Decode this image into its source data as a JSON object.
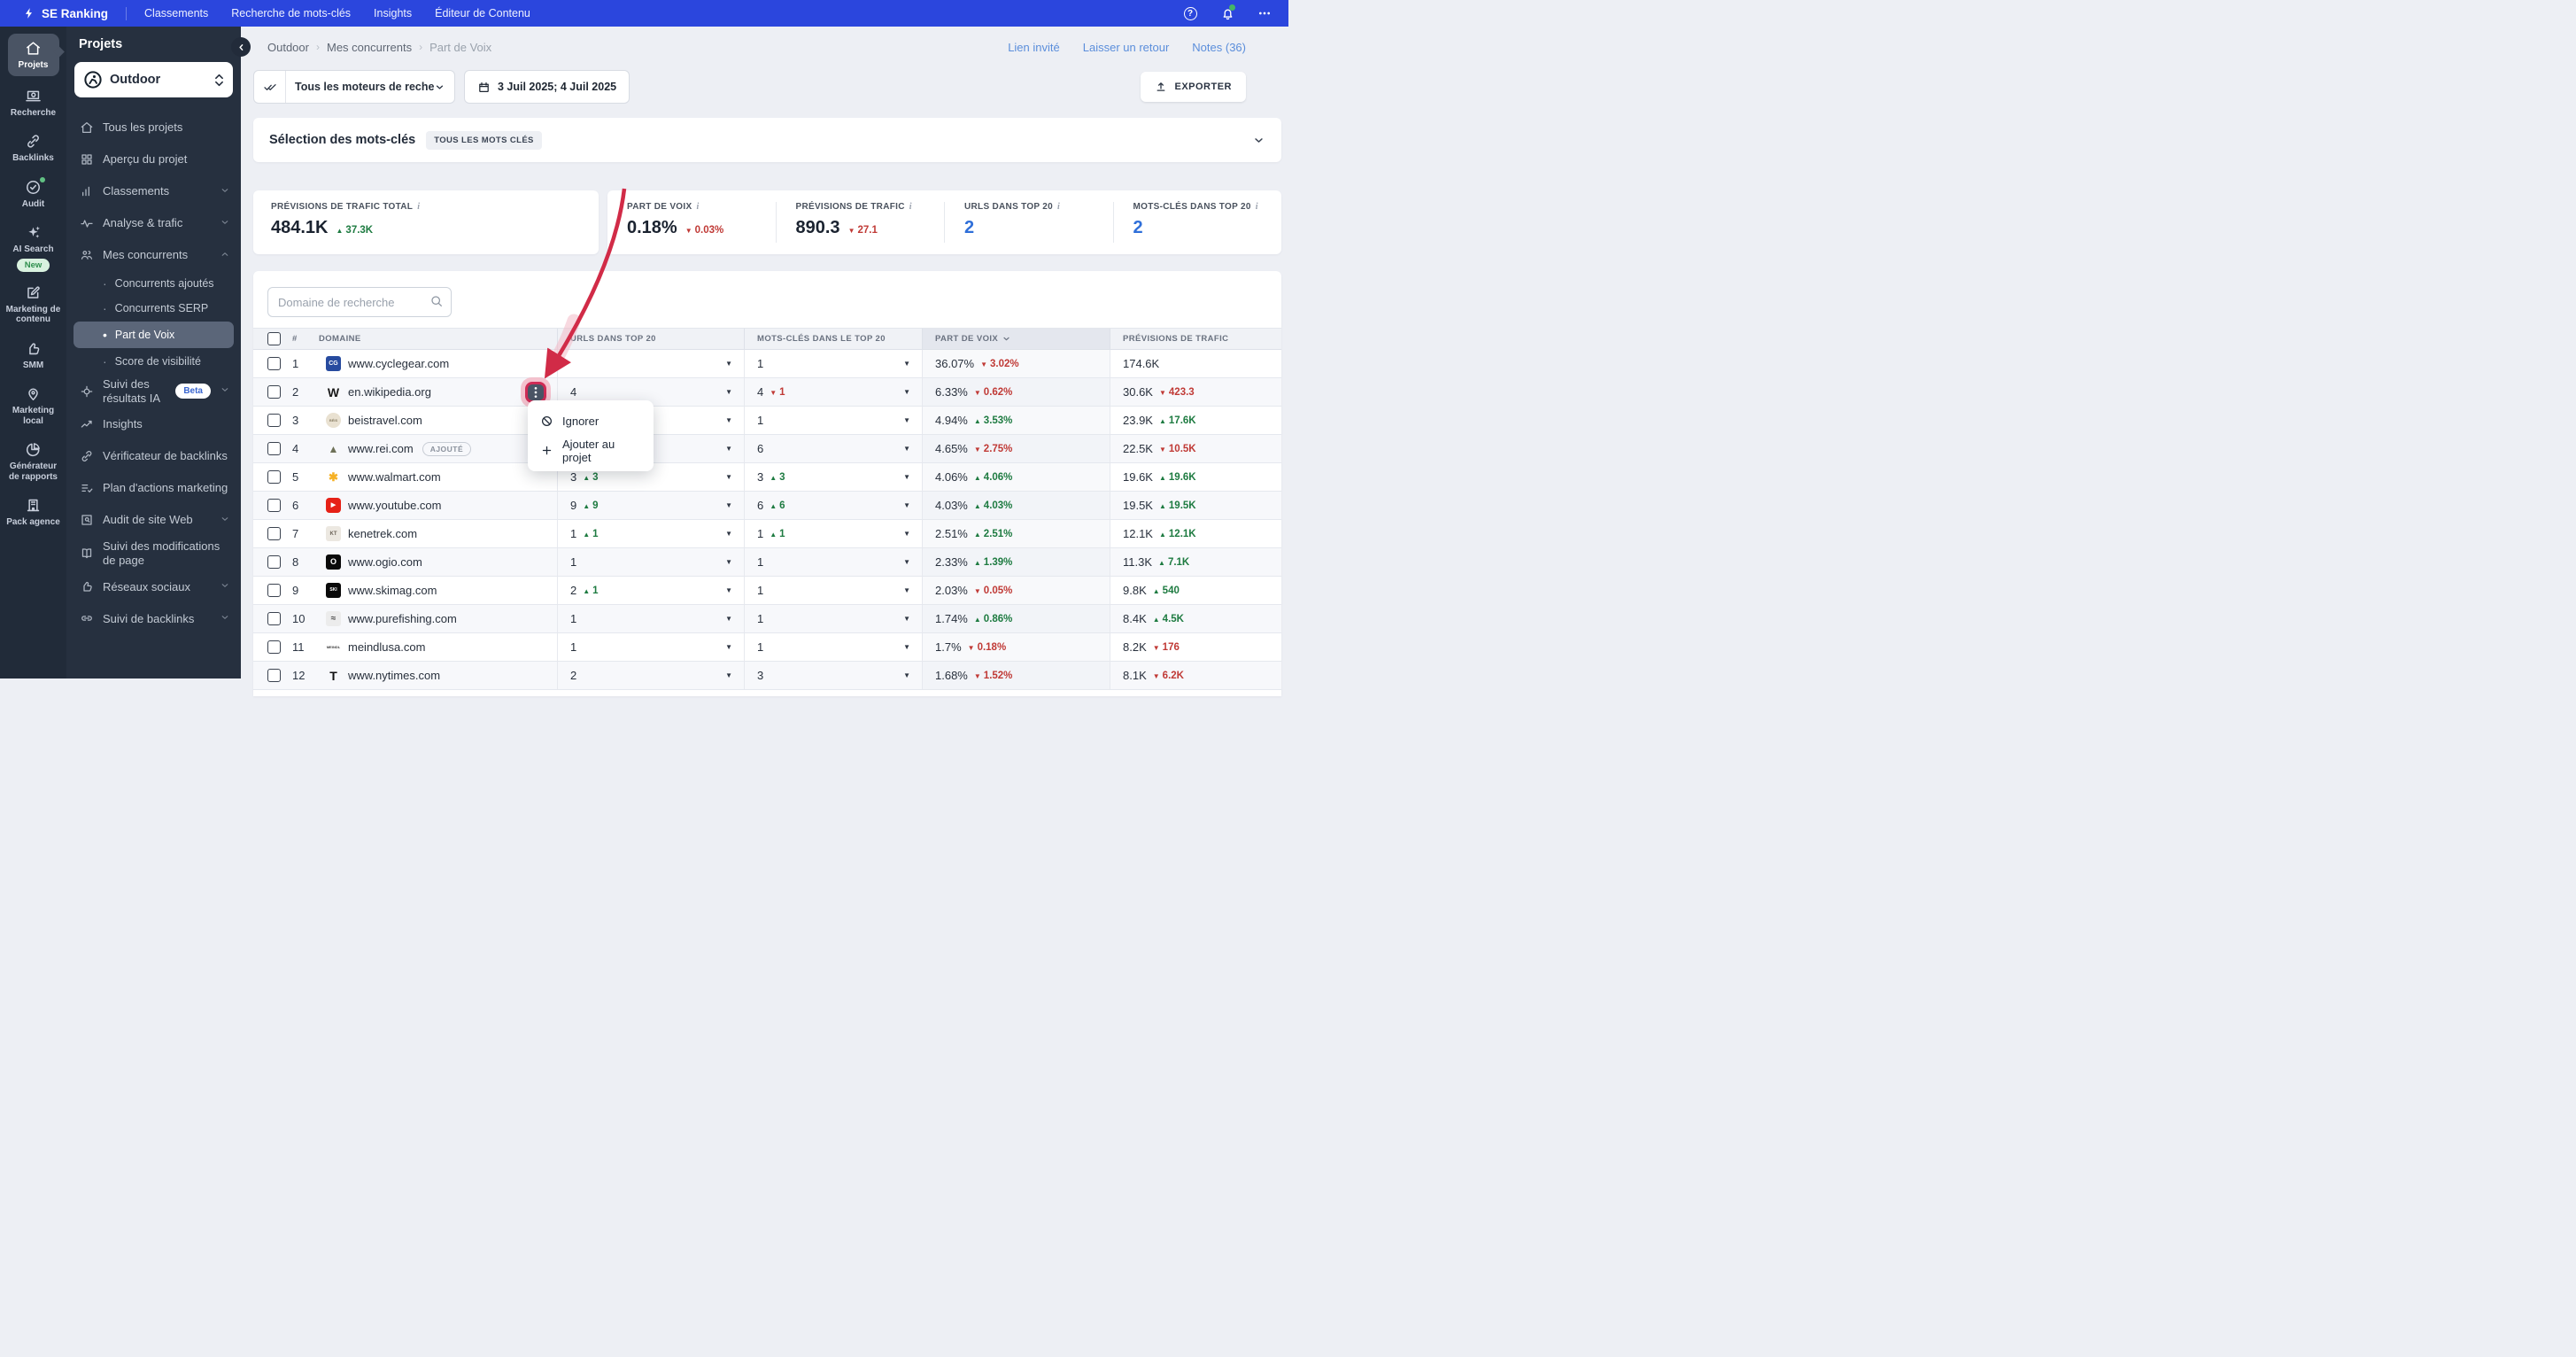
{
  "colors": {
    "topbar": "#2b46dd",
    "rail": "#212b39",
    "panel": "#26303f",
    "active_item": "#5b6679",
    "accent_blue": "#2f6fd9",
    "link_blue": "#5b8edb",
    "up_green": "#1e7b41",
    "down_red": "#c03a36",
    "menu_ring": "#cf2b55",
    "arrow_red": "#d12b47"
  },
  "topnav": {
    "brand": "SE Ranking",
    "items": [
      "Classements",
      "Recherche de mots-clés",
      "Insights",
      "Éditeur de Contenu"
    ],
    "right_icons": [
      "help-icon",
      "notifications-icon",
      "more-icon"
    ]
  },
  "rail": {
    "items": [
      {
        "id": "projects",
        "label": "Projets",
        "icon": "home",
        "active": true
      },
      {
        "id": "research",
        "label": "Recherche",
        "icon": "laptop"
      },
      {
        "id": "backlinks",
        "label": "Backlinks",
        "icon": "link"
      },
      {
        "id": "audit",
        "label": "Audit",
        "icon": "check-circle",
        "dot": true
      },
      {
        "id": "ai-search",
        "label": "AI Search",
        "icon": "sparkles",
        "badge": "New"
      },
      {
        "id": "content-marketing",
        "label": "Marketing de contenu",
        "icon": "pencil-square"
      },
      {
        "id": "smm",
        "label": "SMM",
        "icon": "thumb-up"
      },
      {
        "id": "local-marketing",
        "label": "Marketing local",
        "icon": "map-pin"
      },
      {
        "id": "report-builder",
        "label": "Générateur de rapports",
        "icon": "pie-chart"
      },
      {
        "id": "agency-pack",
        "label": "Pack agence",
        "icon": "building"
      }
    ]
  },
  "sidebar": {
    "title": "Projets",
    "project_name": "Outdoor",
    "items": [
      {
        "id": "all-projects",
        "label": "Tous les projets",
        "icon": "home"
      },
      {
        "id": "project-overview",
        "label": "Aperçu du projet",
        "icon": "grid"
      },
      {
        "id": "rankings",
        "label": "Classements",
        "icon": "bars",
        "chevron": "down"
      },
      {
        "id": "analytics-traffic",
        "label": "Analyse & trafic",
        "icon": "pulse",
        "chevron": "down"
      },
      {
        "id": "my-competitors",
        "label": "Mes concurrents",
        "icon": "people",
        "chevron": "up",
        "sub": [
          {
            "id": "added-competitors",
            "label": "Concurrents ajoutés"
          },
          {
            "id": "serp-competitors",
            "label": "Concurrents SERP"
          },
          {
            "id": "share-of-voice",
            "label": "Part de Voix",
            "active": true
          },
          {
            "id": "visibility-score",
            "label": "Score de visibilité"
          }
        ]
      },
      {
        "id": "ai-results-tracking",
        "label": "Suivi des résultats IA",
        "icon": "crosshair",
        "badge": "Beta",
        "chevron": "down"
      },
      {
        "id": "insights",
        "label": "Insights",
        "icon": "trend"
      },
      {
        "id": "backlink-checker",
        "label": "Vérificateur de backlinks",
        "icon": "link"
      },
      {
        "id": "marketing-plan",
        "label": "Plan d'actions marketing",
        "icon": "checklist"
      },
      {
        "id": "website-audit",
        "label": "Audit de site Web",
        "icon": "audit-site",
        "chevron": "down"
      },
      {
        "id": "page-changes",
        "label": "Suivi des modifications de page",
        "icon": "pages"
      },
      {
        "id": "social-media",
        "label": "Réseaux sociaux",
        "icon": "thumb-up",
        "chevron": "down"
      },
      {
        "id": "backlink-monitoring",
        "label": "Suivi de backlinks",
        "icon": "link-2",
        "chevron": "down"
      }
    ]
  },
  "header": {
    "breadcrumb": [
      "Outdoor",
      "Mes concurrents",
      "Part de Voix"
    ],
    "links": [
      "Lien invité",
      "Laisser un retour",
      "Notes (36)"
    ]
  },
  "filters": {
    "engine": "Tous les moteurs de recher...",
    "date_range": "3 Juil 2025; 4 Juil 2025",
    "export_label": "EXPORTER"
  },
  "selection": {
    "title": "Sélection des mots-clés",
    "badge": "TOUS LES MOTS CLÉS"
  },
  "stats": {
    "total": {
      "label": "PRÉVISIONS DE TRAFIC TOTAL",
      "value": "484.1K",
      "delta": "37.3K",
      "dir": "up"
    },
    "cards": [
      {
        "label": "PART DE VOIX",
        "value": "0.18%",
        "delta": "0.03%",
        "dir": "down"
      },
      {
        "label": "PRÉVISIONS DE TRAFIC",
        "value": "890.3",
        "delta": "27.1",
        "dir": "down"
      },
      {
        "label": "URLS DANS TOP 20",
        "value": "2",
        "blue": true
      },
      {
        "label": "MOTS-CLÉS DANS TOP 20",
        "value": "2",
        "blue": true
      }
    ]
  },
  "table": {
    "search_placeholder": "Domaine de recherche",
    "columns": [
      "#",
      "DOMAINE",
      "URLS DANS TOP 20",
      "MOTS-CLÉS DANS LE TOP 20",
      "PART DE VOIX",
      "PRÉVISIONS DE TRAFIC"
    ],
    "sorted_column": "PART DE VOIX",
    "rows": [
      {
        "n": 1,
        "domain": "www.cyclegear.com",
        "favicon": {
          "shape": "square",
          "bg": "#274b9f",
          "fg": "#ffffff",
          "text": "CG",
          "size": 7
        },
        "urls": {
          "value": ""
        },
        "mots": {
          "value": "1"
        },
        "pdv": {
          "value": "36.07%",
          "delta": "3.02%",
          "dir": "down"
        },
        "prev": {
          "value": "174.6K"
        }
      },
      {
        "n": 2,
        "domain": "en.wikipedia.org",
        "favicon": {
          "shape": "plain",
          "fg": "#1a1a1a",
          "text": "W",
          "serif": true,
          "size": 14
        },
        "menu_open": true,
        "urls": {
          "value": "4"
        },
        "mots": {
          "value": "4",
          "delta": "1",
          "dir": "down"
        },
        "pdv": {
          "value": "6.33%",
          "delta": "0.62%",
          "dir": "down"
        },
        "prev": {
          "value": "30.6K",
          "delta": "423.3",
          "dir": "down"
        }
      },
      {
        "n": 3,
        "domain": "beistravel.com",
        "favicon": {
          "shape": "circle",
          "bg": "#e9e1d1",
          "fg": "#8a7f66",
          "text": "BÉIS",
          "size": 4
        },
        "urls": {
          "value": ""
        },
        "mots": {
          "value": "1"
        },
        "pdv": {
          "value": "4.94%",
          "delta": "3.53%",
          "dir": "up"
        },
        "prev": {
          "value": "23.9K",
          "delta": "17.6K",
          "dir": "up"
        }
      },
      {
        "n": 4,
        "domain": "www.rei.com",
        "badge": "AJOUTÉ",
        "favicon": {
          "shape": "plain",
          "fg": "#6e7158",
          "text": "▲",
          "size": 12
        },
        "urls": {
          "value": ""
        },
        "mots": {
          "value": "6"
        },
        "pdv": {
          "value": "4.65%",
          "delta": "2.75%",
          "dir": "down"
        },
        "prev": {
          "value": "22.5K",
          "delta": "10.5K",
          "dir": "down"
        }
      },
      {
        "n": 5,
        "domain": "www.walmart.com",
        "favicon": {
          "shape": "plain",
          "fg": "#f6b125",
          "text": "✱",
          "size": 13
        },
        "urls": {
          "value": "3",
          "delta": "3",
          "dir": "up"
        },
        "mots": {
          "value": "3",
          "delta": "3",
          "dir": "up"
        },
        "pdv": {
          "value": "4.06%",
          "delta": "4.06%",
          "dir": "up"
        },
        "prev": {
          "value": "19.6K",
          "delta": "19.6K",
          "dir": "up"
        }
      },
      {
        "n": 6,
        "domain": "www.youtube.com",
        "favicon": {
          "shape": "square",
          "bg": "#e62117",
          "fg": "#ffffff",
          "text": "▶",
          "size": 7,
          "radius": 4
        },
        "urls": {
          "value": "9",
          "delta": "9",
          "dir": "up"
        },
        "mots": {
          "value": "6",
          "delta": "6",
          "dir": "up"
        },
        "pdv": {
          "value": "4.03%",
          "delta": "4.03%",
          "dir": "up"
        },
        "prev": {
          "value": "19.5K",
          "delta": "19.5K",
          "dir": "up"
        }
      },
      {
        "n": 7,
        "domain": "kenetrek.com",
        "favicon": {
          "shape": "square",
          "bg": "#ece8e1",
          "fg": "#6b6258",
          "text": "KT",
          "size": 6
        },
        "urls": {
          "value": "1",
          "delta": "1",
          "dir": "up"
        },
        "mots": {
          "value": "1",
          "delta": "1",
          "dir": "up"
        },
        "pdv": {
          "value": "2.51%",
          "delta": "2.51%",
          "dir": "up"
        },
        "prev": {
          "value": "12.1K",
          "delta": "12.1K",
          "dir": "up"
        }
      },
      {
        "n": 8,
        "domain": "www.ogio.com",
        "favicon": {
          "shape": "square",
          "bg": "#0a0a0a",
          "fg": "#ffffff",
          "text": "O",
          "size": 9
        },
        "urls": {
          "value": "1"
        },
        "mots": {
          "value": "1"
        },
        "pdv": {
          "value": "2.33%",
          "delta": "1.39%",
          "dir": "up"
        },
        "prev": {
          "value": "11.3K",
          "delta": "7.1K",
          "dir": "up"
        }
      },
      {
        "n": 9,
        "domain": "www.skimag.com",
        "favicon": {
          "shape": "square",
          "bg": "#0a0a0a",
          "fg": "#ffffff",
          "text": "SKI",
          "size": 5
        },
        "urls": {
          "value": "2",
          "delta": "1",
          "dir": "up"
        },
        "mots": {
          "value": "1"
        },
        "pdv": {
          "value": "2.03%",
          "delta": "0.05%",
          "dir": "down"
        },
        "prev": {
          "value": "9.8K",
          "delta": "540",
          "dir": "up"
        }
      },
      {
        "n": 10,
        "domain": "www.purefishing.com",
        "favicon": {
          "shape": "square",
          "bg": "#ececec",
          "fg": "#4a4a4a",
          "text": "≈",
          "size": 10
        },
        "urls": {
          "value": "1"
        },
        "mots": {
          "value": "1"
        },
        "pdv": {
          "value": "1.74%",
          "delta": "0.86%",
          "dir": "up"
        },
        "prev": {
          "value": "8.4K",
          "delta": "4.5K",
          "dir": "up"
        }
      },
      {
        "n": 11,
        "domain": "meindlusa.com",
        "favicon": {
          "shape": "plain",
          "fg": "#3f3f3f",
          "text": "MEINDL",
          "size": 4
        },
        "urls": {
          "value": "1"
        },
        "mots": {
          "value": "1"
        },
        "pdv": {
          "value": "1.7%",
          "delta": "0.18%",
          "dir": "down"
        },
        "prev": {
          "value": "8.2K",
          "delta": "176",
          "dir": "down"
        }
      },
      {
        "n": 12,
        "domain": "www.nytimes.com",
        "favicon": {
          "shape": "plain",
          "fg": "#111111",
          "text": "T",
          "serif": true,
          "size": 14
        },
        "urls": {
          "value": "2"
        },
        "mots": {
          "value": "3"
        },
        "pdv": {
          "value": "1.68%",
          "delta": "1.52%",
          "dir": "down"
        },
        "prev": {
          "value": "8.1K",
          "delta": "6.2K",
          "dir": "down"
        }
      }
    ]
  },
  "context_menu": {
    "items": [
      {
        "icon": "ban",
        "label": "Ignorer"
      },
      {
        "icon": "plus",
        "label": "Ajouter au projet"
      }
    ]
  }
}
